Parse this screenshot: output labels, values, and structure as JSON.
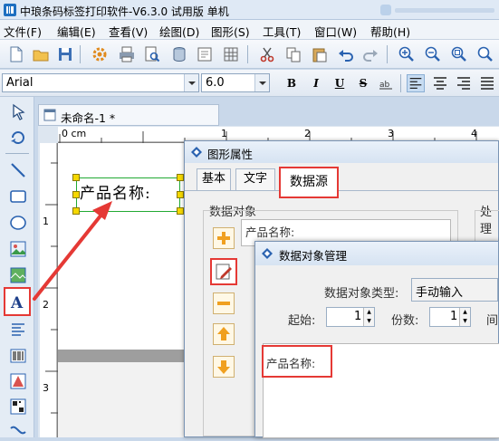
{
  "app": {
    "title": "中琅条码标签打印软件-V6.3.0 试用版 单机"
  },
  "menu": [
    "文件(F)",
    "编辑(E)",
    "查看(V)",
    "绘图(D)",
    "图形(S)",
    "工具(T)",
    "窗口(W)",
    "帮助(H)"
  ],
  "font_toolbar": {
    "font_name": "Arial",
    "font_size": "6.0",
    "bold": "B",
    "italic": "I",
    "underline": "U",
    "strike": "S"
  },
  "document": {
    "tab_title": "未命名-1 *",
    "ruler_origin": "0 cm",
    "ruler_marks": [
      "1",
      "2",
      "3",
      "4"
    ],
    "vruler_marks": [
      "1",
      "2",
      "3"
    ],
    "label_text": "产品名称:"
  },
  "graphic_props_dialog": {
    "title": "图形属性",
    "tabs": [
      "基本",
      "文字",
      "数据源"
    ],
    "active_tab": "数据源",
    "data_objects_label": "数据对象",
    "data_object_item": "产品名称:",
    "process_label": "处理"
  },
  "data_obj_dialog": {
    "title": "数据对象管理",
    "type_label": "数据对象类型:",
    "type_value": "手动输入",
    "start_label": "起始:",
    "start_value": "1",
    "copies_label": "份数:",
    "copies_value": "1",
    "interval_label": "间隔",
    "content": "产品名称:"
  },
  "colors": {
    "accent_red": "#e53935",
    "selection_green": "#22aa33",
    "handle_yellow": "#f5d800"
  }
}
